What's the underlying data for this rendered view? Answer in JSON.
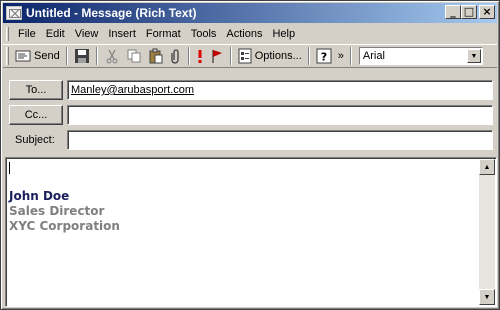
{
  "window": {
    "title": "Untitled - Message (Rich Text)",
    "controls": {
      "minimize": "_",
      "maximize": "□",
      "close": "×"
    }
  },
  "menu": [
    {
      "label": "File"
    },
    {
      "label": "Edit"
    },
    {
      "label": "View"
    },
    {
      "label": "Insert"
    },
    {
      "label": "Format"
    },
    {
      "label": "Tools"
    },
    {
      "label": "Actions"
    },
    {
      "label": "Help"
    }
  ],
  "toolbar": {
    "send_label": "Send",
    "options_label": "Options...",
    "overflow": "»",
    "font_name": "Arial",
    "icons": [
      "send-icon",
      "save-icon",
      "cut-icon",
      "copy-icon",
      "paste-icon",
      "attach-icon",
      "importance-icon",
      "flag-icon",
      "options-icon",
      "help-icon"
    ]
  },
  "headers": {
    "to_label": "To...",
    "to_value": "Manley@arubasport.com",
    "cc_label": "Cc...",
    "cc_value": "",
    "subject_label": "Subject:",
    "subject_value": ""
  },
  "body": {
    "signature": {
      "name": "John Doe",
      "title": "Sales Director",
      "company": "XYC Corporation"
    }
  },
  "colors": {
    "title_gradient_start": "#0a246a",
    "title_gradient_end": "#a6caf0",
    "chrome": "#d4d0c8",
    "signature_name": "#1a1f5e",
    "signature_text": "#808080",
    "importance": "#e00000"
  }
}
